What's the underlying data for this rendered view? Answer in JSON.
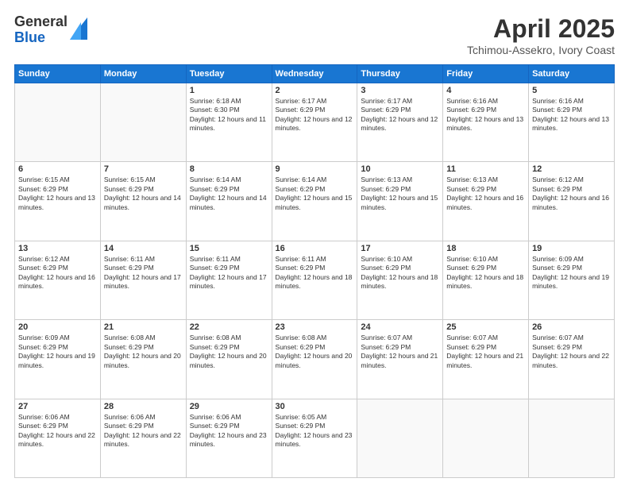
{
  "logo": {
    "general": "General",
    "blue": "Blue"
  },
  "title": "April 2025",
  "subtitle": "Tchimou-Assekro, Ivory Coast",
  "header_days": [
    "Sunday",
    "Monday",
    "Tuesday",
    "Wednesday",
    "Thursday",
    "Friday",
    "Saturday"
  ],
  "weeks": [
    [
      {
        "day": "",
        "info": ""
      },
      {
        "day": "",
        "info": ""
      },
      {
        "day": "1",
        "info": "Sunrise: 6:18 AM\nSunset: 6:30 PM\nDaylight: 12 hours and 11 minutes."
      },
      {
        "day": "2",
        "info": "Sunrise: 6:17 AM\nSunset: 6:29 PM\nDaylight: 12 hours and 12 minutes."
      },
      {
        "day": "3",
        "info": "Sunrise: 6:17 AM\nSunset: 6:29 PM\nDaylight: 12 hours and 12 minutes."
      },
      {
        "day": "4",
        "info": "Sunrise: 6:16 AM\nSunset: 6:29 PM\nDaylight: 12 hours and 13 minutes."
      },
      {
        "day": "5",
        "info": "Sunrise: 6:16 AM\nSunset: 6:29 PM\nDaylight: 12 hours and 13 minutes."
      }
    ],
    [
      {
        "day": "6",
        "info": "Sunrise: 6:15 AM\nSunset: 6:29 PM\nDaylight: 12 hours and 13 minutes."
      },
      {
        "day": "7",
        "info": "Sunrise: 6:15 AM\nSunset: 6:29 PM\nDaylight: 12 hours and 14 minutes."
      },
      {
        "day": "8",
        "info": "Sunrise: 6:14 AM\nSunset: 6:29 PM\nDaylight: 12 hours and 14 minutes."
      },
      {
        "day": "9",
        "info": "Sunrise: 6:14 AM\nSunset: 6:29 PM\nDaylight: 12 hours and 15 minutes."
      },
      {
        "day": "10",
        "info": "Sunrise: 6:13 AM\nSunset: 6:29 PM\nDaylight: 12 hours and 15 minutes."
      },
      {
        "day": "11",
        "info": "Sunrise: 6:13 AM\nSunset: 6:29 PM\nDaylight: 12 hours and 16 minutes."
      },
      {
        "day": "12",
        "info": "Sunrise: 6:12 AM\nSunset: 6:29 PM\nDaylight: 12 hours and 16 minutes."
      }
    ],
    [
      {
        "day": "13",
        "info": "Sunrise: 6:12 AM\nSunset: 6:29 PM\nDaylight: 12 hours and 16 minutes."
      },
      {
        "day": "14",
        "info": "Sunrise: 6:11 AM\nSunset: 6:29 PM\nDaylight: 12 hours and 17 minutes."
      },
      {
        "day": "15",
        "info": "Sunrise: 6:11 AM\nSunset: 6:29 PM\nDaylight: 12 hours and 17 minutes."
      },
      {
        "day": "16",
        "info": "Sunrise: 6:11 AM\nSunset: 6:29 PM\nDaylight: 12 hours and 18 minutes."
      },
      {
        "day": "17",
        "info": "Sunrise: 6:10 AM\nSunset: 6:29 PM\nDaylight: 12 hours and 18 minutes."
      },
      {
        "day": "18",
        "info": "Sunrise: 6:10 AM\nSunset: 6:29 PM\nDaylight: 12 hours and 18 minutes."
      },
      {
        "day": "19",
        "info": "Sunrise: 6:09 AM\nSunset: 6:29 PM\nDaylight: 12 hours and 19 minutes."
      }
    ],
    [
      {
        "day": "20",
        "info": "Sunrise: 6:09 AM\nSunset: 6:29 PM\nDaylight: 12 hours and 19 minutes."
      },
      {
        "day": "21",
        "info": "Sunrise: 6:08 AM\nSunset: 6:29 PM\nDaylight: 12 hours and 20 minutes."
      },
      {
        "day": "22",
        "info": "Sunrise: 6:08 AM\nSunset: 6:29 PM\nDaylight: 12 hours and 20 minutes."
      },
      {
        "day": "23",
        "info": "Sunrise: 6:08 AM\nSunset: 6:29 PM\nDaylight: 12 hours and 20 minutes."
      },
      {
        "day": "24",
        "info": "Sunrise: 6:07 AM\nSunset: 6:29 PM\nDaylight: 12 hours and 21 minutes."
      },
      {
        "day": "25",
        "info": "Sunrise: 6:07 AM\nSunset: 6:29 PM\nDaylight: 12 hours and 21 minutes."
      },
      {
        "day": "26",
        "info": "Sunrise: 6:07 AM\nSunset: 6:29 PM\nDaylight: 12 hours and 22 minutes."
      }
    ],
    [
      {
        "day": "27",
        "info": "Sunrise: 6:06 AM\nSunset: 6:29 PM\nDaylight: 12 hours and 22 minutes."
      },
      {
        "day": "28",
        "info": "Sunrise: 6:06 AM\nSunset: 6:29 PM\nDaylight: 12 hours and 22 minutes."
      },
      {
        "day": "29",
        "info": "Sunrise: 6:06 AM\nSunset: 6:29 PM\nDaylight: 12 hours and 23 minutes."
      },
      {
        "day": "30",
        "info": "Sunrise: 6:05 AM\nSunset: 6:29 PM\nDaylight: 12 hours and 23 minutes."
      },
      {
        "day": "",
        "info": ""
      },
      {
        "day": "",
        "info": ""
      },
      {
        "day": "",
        "info": ""
      }
    ]
  ]
}
